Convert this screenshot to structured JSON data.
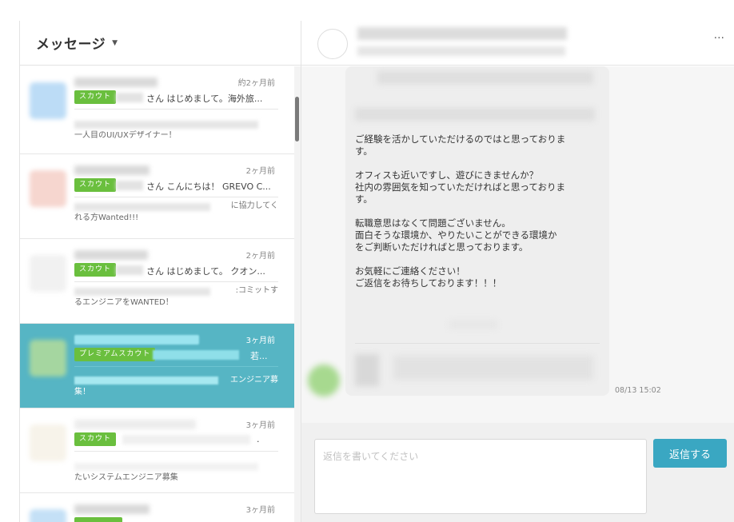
{
  "sidebar": {
    "title": "メッセージ",
    "items": [
      {
        "time": "約2ヶ月前",
        "tag": "スカウト",
        "subject": "さん はじめまして。海外旅...",
        "preview": "一人目のUI/UXデザイナー！",
        "preview_right": ""
      },
      {
        "time": "2ヶ月前",
        "tag": "スカウト",
        "subject": "さん こんにちは！ GREVO C...",
        "preview": "れる方Wanted!!!",
        "preview_right": "に協力してく"
      },
      {
        "time": "2ヶ月前",
        "tag": "スカウト",
        "subject": "さん はじめまして。 クオン...",
        "preview": "るエンジニアをWANTED！",
        "preview_right": ":コミットす"
      },
      {
        "time": "3ヶ月前",
        "tag": "プレミアムスカウト",
        "subject": "若...",
        "preview": "集！",
        "preview_right": "エンジニア募"
      },
      {
        "time": "3ヶ月前",
        "tag": "スカウト",
        "subject": ".",
        "preview": "たいシステムエンジニア募集",
        "preview_right": ""
      },
      {
        "time": "3ヶ月前",
        "tag": "",
        "subject": "",
        "preview": "",
        "preview_right": ""
      }
    ]
  },
  "thread": {
    "more_label": "···",
    "message_text": "ご経験を活かしていただけるのではと思っておりま\nす。\n\nオフィスも近いですし、遊びにきませんか？\n社内の雰囲気を知っていただければと思っておりま\nす。\n\n転職意思はなくて問題ございません。\n面白そうな環境か、やりたいことができる環境か\nをご判断いただければと思っております。\n\nお気軽にご連絡ください！\nご返信をお待ちしております！！！",
    "time": "08/13 15:02"
  },
  "compose": {
    "placeholder": "返信を書いてください",
    "send_label": "返信する"
  },
  "colors": {
    "accent": "#56b5c4",
    "tag_green": "#6abf3e",
    "send_button": "#3aa7c2"
  }
}
